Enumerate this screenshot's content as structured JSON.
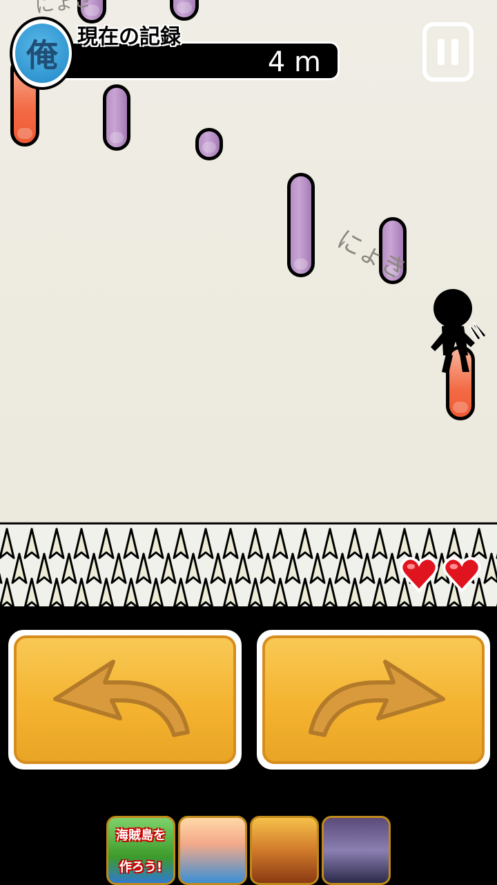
{
  "hud": {
    "badge_icon": "ore-kanji-badge",
    "badge_char": "俺",
    "record_title": "現在の記録",
    "record_value": "4 m",
    "pause_icon": "pause-icon"
  },
  "scene": {
    "sfx_top": "にょき",
    "sfx_mid": "にょき",
    "hearts": [
      "heart-icon",
      "heart-icon"
    ],
    "lives": 2,
    "pillar_colors": {
      "purple": "#c09ad0",
      "orange": "#f26440"
    }
  },
  "controls": {
    "left_icon": "curved-arrow-left-icon",
    "right_icon": "curved-arrow-right-icon",
    "button_color": "#f4b330"
  },
  "ads": [
    {
      "name": "ad-pirate-island",
      "label_line1": "海賊島を",
      "label_line2": "作ろう!"
    },
    {
      "name": "ad-mermaid-game",
      "label_line1": "",
      "label_line2": ""
    },
    {
      "name": "ad-warrior-game",
      "label_line1": "",
      "label_line2": ""
    },
    {
      "name": "ad-samurai-game",
      "label_line1": "",
      "label_line2": ""
    }
  ]
}
